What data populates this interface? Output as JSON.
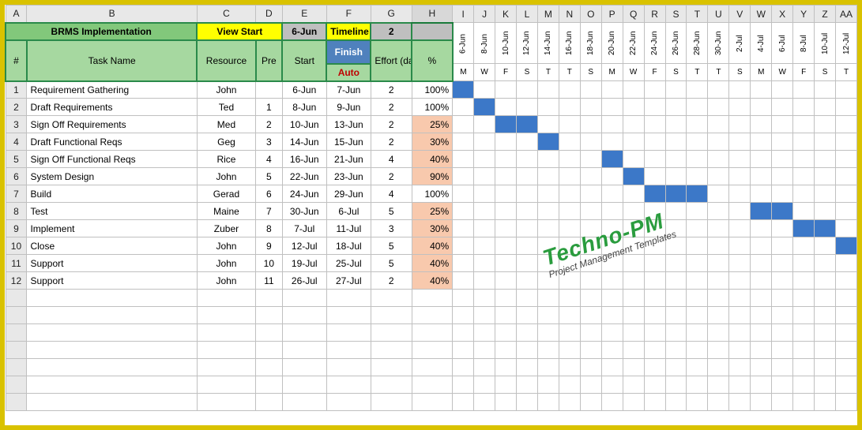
{
  "cols": [
    "A",
    "B",
    "C",
    "D",
    "E",
    "F",
    "G",
    "H",
    "I",
    "J",
    "K",
    "L",
    "M",
    "N",
    "O",
    "P",
    "Q",
    "R",
    "S",
    "T",
    "U",
    "V",
    "W",
    "X",
    "Y",
    "Z",
    "AA"
  ],
  "title": "BRMS Implementation",
  "header1": {
    "view_start": "View Start",
    "date": "6-Jun",
    "timeline": "Timeline",
    "tl_val": "2"
  },
  "header2": {
    "num": "#",
    "task": "Task Name",
    "resource": "Resource",
    "pre": "Pre",
    "start": "Start",
    "finish": "Finish",
    "auto": "Auto",
    "effort": "Effort (days)",
    "pct": "%"
  },
  "timeline_dates": [
    "6-Jun",
    "8-Jun",
    "10-Jun",
    "12-Jun",
    "14-Jun",
    "16-Jun",
    "18-Jun",
    "20-Jun",
    "22-Jun",
    "24-Jun",
    "26-Jun",
    "28-Jun",
    "30-Jun",
    "2-Jul",
    "4-Jul",
    "6-Jul",
    "8-Jul",
    "10-Jul",
    "12-Jul"
  ],
  "timeline_days": [
    "M",
    "W",
    "F",
    "S",
    "T",
    "T",
    "S",
    "M",
    "W",
    "F",
    "S",
    "T",
    "T",
    "S",
    "M",
    "W",
    "F",
    "S",
    "T"
  ],
  "rows": [
    {
      "n": "1",
      "task": "Requirement Gathering",
      "res": "John",
      "pre": "",
      "start": "6-Jun",
      "finish": "7-Jun",
      "eff": "2",
      "pct": "100%",
      "pct_hi": false,
      "bar_start": 0,
      "bar_len": 1
    },
    {
      "n": "2",
      "task": "Draft  Requirements",
      "res": "Ted",
      "pre": "1",
      "start": "8-Jun",
      "finish": "9-Jun",
      "eff": "2",
      "pct": "100%",
      "pct_hi": false,
      "bar_start": 1,
      "bar_len": 1
    },
    {
      "n": "3",
      "task": "Sign Off  Requirements",
      "res": "Med",
      "pre": "2",
      "start": "10-Jun",
      "finish": "13-Jun",
      "eff": "2",
      "pct": "25%",
      "pct_hi": true,
      "bar_start": 2,
      "bar_len": 2
    },
    {
      "n": "4",
      "task": "Draft Functional Reqs",
      "res": "Geg",
      "pre": "3",
      "start": "14-Jun",
      "finish": "15-Jun",
      "eff": "2",
      "pct": "30%",
      "pct_hi": true,
      "bar_start": 4,
      "bar_len": 1
    },
    {
      "n": "5",
      "task": "Sign Off Functional Reqs",
      "res": "Rice",
      "pre": "4",
      "start": "16-Jun",
      "finish": "21-Jun",
      "eff": "4",
      "pct": "40%",
      "pct_hi": true,
      "bar_start": 7,
      "bar_len": 1
    },
    {
      "n": "6",
      "task": "System Design",
      "res": "John",
      "pre": "5",
      "start": "22-Jun",
      "finish": "23-Jun",
      "eff": "2",
      "pct": "90%",
      "pct_hi": true,
      "bar_start": 8,
      "bar_len": 1
    },
    {
      "n": "7",
      "task": "Build",
      "res": "Gerad",
      "pre": "6",
      "start": "24-Jun",
      "finish": "29-Jun",
      "eff": "4",
      "pct": "100%",
      "pct_hi": false,
      "bar_start": 9,
      "bar_len": 3
    },
    {
      "n": "8",
      "task": "Test",
      "res": "Maine",
      "pre": "7",
      "start": "30-Jun",
      "finish": "6-Jul",
      "eff": "5",
      "pct": "25%",
      "pct_hi": true,
      "bar_start": 14,
      "bar_len": 2
    },
    {
      "n": "9",
      "task": "Implement",
      "res": "Zuber",
      "pre": "8",
      "start": "7-Jul",
      "finish": "11-Jul",
      "eff": "3",
      "pct": "30%",
      "pct_hi": true,
      "bar_start": 16,
      "bar_len": 2
    },
    {
      "n": "10",
      "task": "Close",
      "res": "John",
      "pre": "9",
      "start": "12-Jul",
      "finish": "18-Jul",
      "eff": "5",
      "pct": "40%",
      "pct_hi": true,
      "bar_start": 18,
      "bar_len": 1
    },
    {
      "n": "11",
      "task": "Support",
      "res": "John",
      "pre": "10",
      "start": "19-Jul",
      "finish": "25-Jul",
      "eff": "5",
      "pct": "40%",
      "pct_hi": true,
      "bar_start": -1,
      "bar_len": 0
    },
    {
      "n": "12",
      "task": "Support",
      "res": "John",
      "pre": "11",
      "start": "26-Jul",
      "finish": "27-Jul",
      "eff": "2",
      "pct": "40%",
      "pct_hi": true,
      "bar_start": -1,
      "bar_len": 0
    }
  ],
  "watermark": {
    "brand": "Techno-PM",
    "sub": "Project Management Templates"
  }
}
